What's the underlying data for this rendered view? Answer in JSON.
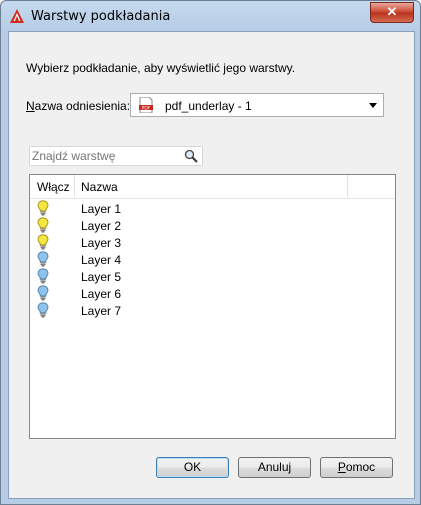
{
  "window": {
    "title": "Warstwy podkładania",
    "close_label": "✕"
  },
  "dialog": {
    "instruction": "Wybierz podkładanie, aby wyświetlić jego warstwy.",
    "reference_label_first": "N",
    "reference_label_rest": "azwa odniesienia:",
    "reference_value": "pdf_underlay - 1",
    "reference_icon": "pdf-file-icon",
    "search_placeholder": "Znajdź warstwę"
  },
  "layer_list": {
    "columns": [
      "Włącz",
      "Nazwa"
    ],
    "rows": [
      {
        "name": "Layer 1",
        "on": true
      },
      {
        "name": "Layer 2",
        "on": true
      },
      {
        "name": "Layer 3",
        "on": true
      },
      {
        "name": "Layer 4",
        "on": false
      },
      {
        "name": "Layer 5",
        "on": false
      },
      {
        "name": "Layer 6",
        "on": false
      },
      {
        "name": "Layer 7",
        "on": false
      }
    ],
    "colors": {
      "on": "#f3e640",
      "off": "#8fc3ee"
    }
  },
  "buttons": {
    "ok": "OK",
    "cancel": "Anuluj",
    "help_first": "P",
    "help_rest": "omoc"
  }
}
